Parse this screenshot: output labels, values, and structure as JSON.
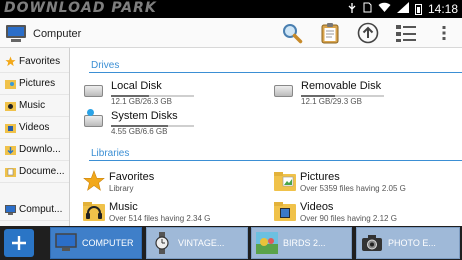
{
  "statusbar": {
    "watermark": "DOWNLOAD PARK",
    "time": "14:18",
    "icons": [
      "usb-icon",
      "sim-icon",
      "wifi-icon",
      "signal-icon",
      "battery-icon"
    ]
  },
  "actionbar": {
    "title": "Computer",
    "tools": [
      "search-icon",
      "clipboard-icon",
      "up-arrow-icon",
      "view-mode-icon",
      "overflow-menu-icon"
    ]
  },
  "sidebar": {
    "items": [
      {
        "label": "Favorites",
        "icon": "star-icon"
      },
      {
        "label": "Pictures",
        "icon": "picture-folder-icon"
      },
      {
        "label": "Music",
        "icon": "music-folder-icon"
      },
      {
        "label": "Videos",
        "icon": "video-folder-icon"
      },
      {
        "label": "Downlo...",
        "icon": "download-folder-icon"
      },
      {
        "label": "Docume...",
        "icon": "document-folder-icon"
      },
      {
        "label": "Comput...",
        "icon": "computer-icon"
      }
    ]
  },
  "drives": {
    "title": "Drives",
    "items": [
      {
        "name": "Local Disk",
        "size": "12.1 GB/26.3 GB",
        "used_fraction": 0.46
      },
      {
        "name": "Removable Disk",
        "size": "12.1 GB/29.3 GB",
        "used_fraction": 0.41
      },
      {
        "name": "System Disks",
        "size": "4.55 GB/6.6 GB",
        "used_fraction": 0.69
      }
    ]
  },
  "libraries": {
    "title": "Libraries",
    "items": [
      {
        "name": "Favorites",
        "desc": "Library",
        "icon": "star-icon"
      },
      {
        "name": "Pictures",
        "desc": "Over 5359 files having 2.05 G",
        "icon": "picture-folder-icon"
      },
      {
        "name": "Music",
        "desc": "Over 514 files having 2.34 G",
        "icon": "music-folder-icon"
      },
      {
        "name": "Videos",
        "desc": "Over 90 files having 2.12 G",
        "icon": "video-folder-icon"
      }
    ]
  },
  "taskbar": {
    "tabs": [
      {
        "label": "COMPUTER",
        "icon": "computer-icon",
        "active": true
      },
      {
        "label": "VINTAGE...",
        "icon": "watch-icon",
        "active": false
      },
      {
        "label": "BIRDS 2...",
        "icon": "image-icon",
        "active": false
      },
      {
        "label": "PHOTO E...",
        "icon": "camera-icon",
        "active": false
      }
    ]
  },
  "colors": {
    "accent": "#3b8fd4",
    "active_tab": "#3f7fc9",
    "inactive_tab": "#9fb9d8",
    "add_button": "#2a75c6"
  }
}
